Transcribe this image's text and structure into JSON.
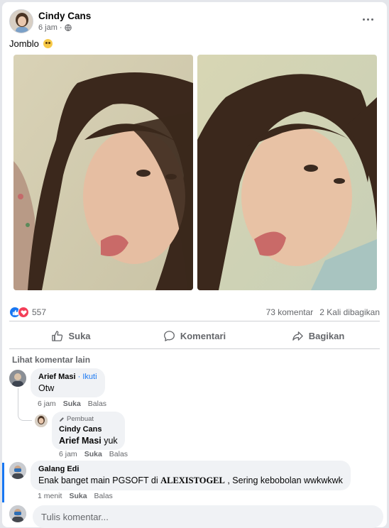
{
  "post": {
    "author": "Cindy Cans",
    "time": "6 jam",
    "text": "Jomblo",
    "emoji_icon": "flushed-face-icon"
  },
  "stats": {
    "reaction_count": "557",
    "comments": "73 komentar",
    "shares": "2 Kali dibagikan"
  },
  "actions": {
    "like": "Suka",
    "comment": "Komentari",
    "share": "Bagikan"
  },
  "comments_section": {
    "more_label": "Lihat komentar lain",
    "comments": [
      {
        "name": "Arief Masi",
        "follow": "· Ikuti",
        "text": "Otw",
        "time": "6 jam",
        "like": "Suka",
        "reply": "Balas"
      },
      {
        "badge": "Pembuat",
        "name": "Cindy Cans",
        "mention": "Arief Masi",
        "text": " yuk",
        "time": "6 jam",
        "like": "Suka",
        "reply": "Balas"
      },
      {
        "name": "Galang Edi",
        "text_pre": "Enak banget main PGSOFT di ",
        "text_bold": "ALEXISTOGEL",
        "text_post": " , Sering kebobolan wwkwkwk",
        "time": "1 menit",
        "like": "Suka",
        "reply": "Balas"
      }
    ]
  },
  "composer": {
    "placeholder": "Tulis komentar..."
  },
  "colors": {
    "accent": "#1877f2",
    "love": "#f33e58",
    "muted": "#65676b",
    "bubble": "#f0f2f5"
  }
}
